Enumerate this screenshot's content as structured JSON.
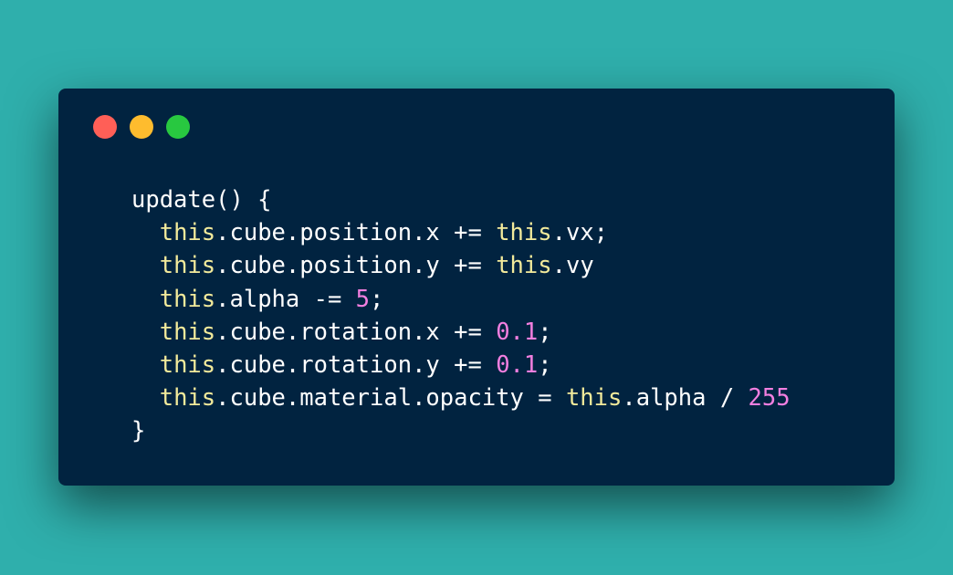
{
  "colors": {
    "background": "#2fafac",
    "window": "#012340",
    "text": "#ffffff",
    "keyword": "#f2ea9b",
    "number": "#f37fe0"
  },
  "window_controls": [
    {
      "name": "close",
      "color": "#ff5f57"
    },
    {
      "name": "minimize",
      "color": "#febc2e"
    },
    {
      "name": "maximize",
      "color": "#28c840"
    }
  ],
  "code_lines": [
    {
      "indent": "",
      "tokens": [
        {
          "t": "update() {",
          "k": "plain"
        }
      ]
    },
    {
      "indent": "  ",
      "tokens": [
        {
          "t": "this",
          "k": "keyword"
        },
        {
          "t": ".cube.position.x += ",
          "k": "plain"
        },
        {
          "t": "this",
          "k": "keyword"
        },
        {
          "t": ".vx;",
          "k": "plain"
        }
      ]
    },
    {
      "indent": "  ",
      "tokens": [
        {
          "t": "this",
          "k": "keyword"
        },
        {
          "t": ".cube.position.y += ",
          "k": "plain"
        },
        {
          "t": "this",
          "k": "keyword"
        },
        {
          "t": ".vy",
          "k": "plain"
        }
      ]
    },
    {
      "indent": "  ",
      "tokens": [
        {
          "t": "this",
          "k": "keyword"
        },
        {
          "t": ".alpha -= ",
          "k": "plain"
        },
        {
          "t": "5",
          "k": "number"
        },
        {
          "t": ";",
          "k": "plain"
        }
      ]
    },
    {
      "indent": "  ",
      "tokens": [
        {
          "t": "this",
          "k": "keyword"
        },
        {
          "t": ".cube.rotation.x += ",
          "k": "plain"
        },
        {
          "t": "0.1",
          "k": "number"
        },
        {
          "t": ";",
          "k": "plain"
        }
      ]
    },
    {
      "indent": "  ",
      "tokens": [
        {
          "t": "this",
          "k": "keyword"
        },
        {
          "t": ".cube.rotation.y += ",
          "k": "plain"
        },
        {
          "t": "0.1",
          "k": "number"
        },
        {
          "t": ";",
          "k": "plain"
        }
      ]
    },
    {
      "indent": "  ",
      "tokens": [
        {
          "t": "this",
          "k": "keyword"
        },
        {
          "t": ".cube.material.opacity = ",
          "k": "plain"
        },
        {
          "t": "this",
          "k": "keyword"
        },
        {
          "t": ".alpha / ",
          "k": "plain"
        },
        {
          "t": "255",
          "k": "number"
        }
      ]
    },
    {
      "indent": "",
      "tokens": [
        {
          "t": "}",
          "k": "plain"
        }
      ]
    }
  ]
}
